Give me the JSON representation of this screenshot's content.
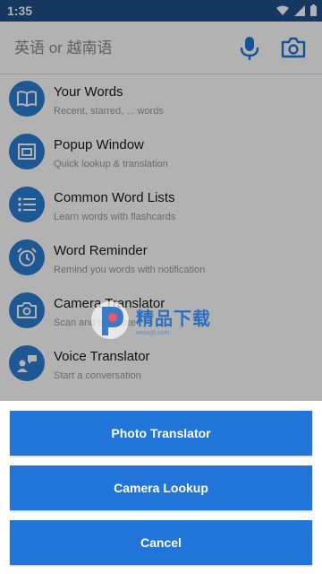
{
  "status_bar": {
    "time": "1:35"
  },
  "search": {
    "placeholder": "英语 or 越南语"
  },
  "menu": {
    "items": [
      {
        "title": "Your Words",
        "subtitle": "Recent, starred, ... words",
        "icon": "book-icon"
      },
      {
        "title": "Popup Window",
        "subtitle": "Quick lookup & translation",
        "icon": "popup-window-icon"
      },
      {
        "title": "Common Word Lists",
        "subtitle": "Learn words with flashcards",
        "icon": "list-icon"
      },
      {
        "title": "Word Reminder",
        "subtitle": "Remind you words with notification",
        "icon": "alarm-icon"
      },
      {
        "title": "Camera Translator",
        "subtitle": "Scan and translate",
        "icon": "camera-icon"
      },
      {
        "title": "Voice Translator",
        "subtitle": "Start a conversation",
        "icon": "voice-chat-icon"
      }
    ]
  },
  "watermark": {
    "title": "精品下载",
    "url": "www.jb.com"
  },
  "sheet": {
    "photo_translator": "Photo Translator",
    "camera_lookup": "Camera Lookup",
    "cancel": "Cancel"
  },
  "colors": {
    "primary": "#2174d8",
    "status_bar": "#1f4f8a",
    "icon_circle": "#2a7fd4"
  }
}
